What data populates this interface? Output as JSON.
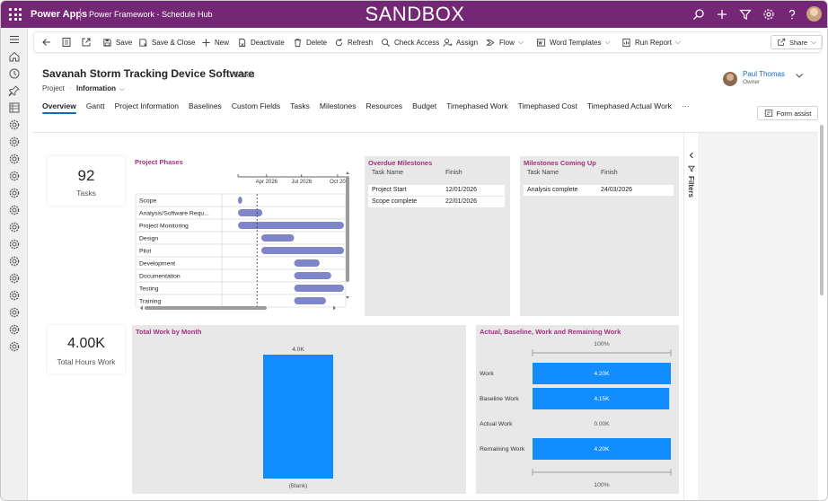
{
  "topbar": {
    "brand": "Power Apps",
    "app_title": "Power Framework - Schedule Hub",
    "environment_banner": "SANDBOX",
    "icons": [
      "search-icon",
      "plus-icon",
      "filter-icon",
      "gear-icon",
      "help-icon",
      "user-avatar"
    ]
  },
  "commandbar": {
    "back": "back-icon",
    "save": "Save",
    "save_close": "Save & Close",
    "new": "New",
    "deactivate": "Deactivate",
    "delete": "Delete",
    "refresh": "Refresh",
    "check_access": "Check Access",
    "assign": "Assign",
    "flow": "Flow",
    "word_templates": "Word Templates",
    "run_report": "Run Report",
    "share": "Share"
  },
  "record": {
    "title": "Savanah Storm Tracking Device Software",
    "saved_status": "- Saved",
    "entity": "Project",
    "entity_sep": "·",
    "form_name": "Information",
    "owner_name": "Paul Thomas",
    "owner_role": "Owner"
  },
  "tabs": [
    "Overview",
    "Gantt",
    "Project Information",
    "Baselines",
    "Custom Fields",
    "Tasks",
    "Milestones",
    "Resources",
    "Budget",
    "Timephased Work",
    "Timephased Cost",
    "Timephased Actual Work",
    "···"
  ],
  "form_assist": "Form assist",
  "report": {
    "kpi_tasks": {
      "value": "92",
      "label": "Tasks"
    },
    "kpi_hours": {
      "value": "4.00K",
      "label": "Total Hours Work"
    },
    "filters_label": "Filters",
    "project_phases": {
      "title": "Project Phases",
      "axis_ticks": [
        "Apr 2026",
        "Jul 2026",
        "Oct 20"
      ],
      "tasks": [
        {
          "name": "Scope",
          "start": 0.0,
          "end": 0.04
        },
        {
          "name": "Analysis/Software Requ...",
          "start": 0.0,
          "end": 0.23
        },
        {
          "name": "Project Monitoring",
          "start": 0.0,
          "end": 1.0
        },
        {
          "name": "Design",
          "start": 0.22,
          "end": 0.53
        },
        {
          "name": "Pilot",
          "start": 0.22,
          "end": 1.0
        },
        {
          "name": "Development",
          "start": 0.53,
          "end": 0.77
        },
        {
          "name": "Documentation",
          "start": 0.53,
          "end": 0.88
        },
        {
          "name": "Testing",
          "start": 0.53,
          "end": 1.0
        },
        {
          "name": "Training",
          "start": 0.53,
          "end": 0.83
        }
      ],
      "today_marker": 0.18
    },
    "overdue": {
      "title": "Overdue Milestones",
      "col1": "Task Name",
      "col2": "Finish",
      "rows": [
        [
          "Project Start",
          "12/01/2026"
        ],
        [
          "Scope complete",
          "22/01/2026"
        ]
      ]
    },
    "upcoming": {
      "title": "Milestones Coming Up",
      "col1": "Task Name",
      "col2": "Finish",
      "rows": [
        [
          "Analysis complete",
          "24/03/2026"
        ]
      ]
    },
    "total_work": {
      "title": "Total Work by Month",
      "value_label": "4.0K",
      "category": "(Blank)"
    },
    "awr": {
      "title": "Actual, Baseline, Work and Remaining Work",
      "top_axis": "100%",
      "bottom_axis": "100%"
    }
  },
  "chart_data": [
    {
      "type": "bar",
      "title": "Total Work by Month",
      "categories": [
        "(Blank)"
      ],
      "values": [
        4000
      ],
      "ylim": [
        0,
        4000
      ],
      "color": "#118dff"
    },
    {
      "type": "bar",
      "title": "Actual, Baseline, Work and Remaining Work",
      "categories": [
        "Work",
        "Baseline Work",
        "Actual Work",
        "Remaining Work"
      ],
      "values": [
        4200,
        4150,
        0,
        4200
      ],
      "labels": [
        "4.20K",
        "4.15K",
        "0.00K",
        "4.20K"
      ],
      "xlim": [
        0,
        4200
      ],
      "color": "#118dff"
    }
  ],
  "colors": {
    "topbar": "#742774",
    "accent": "#0f6cbd",
    "panel_title": "#a3307f",
    "gantt_bar": "#7e85c9",
    "bar_blue": "#118dff"
  }
}
